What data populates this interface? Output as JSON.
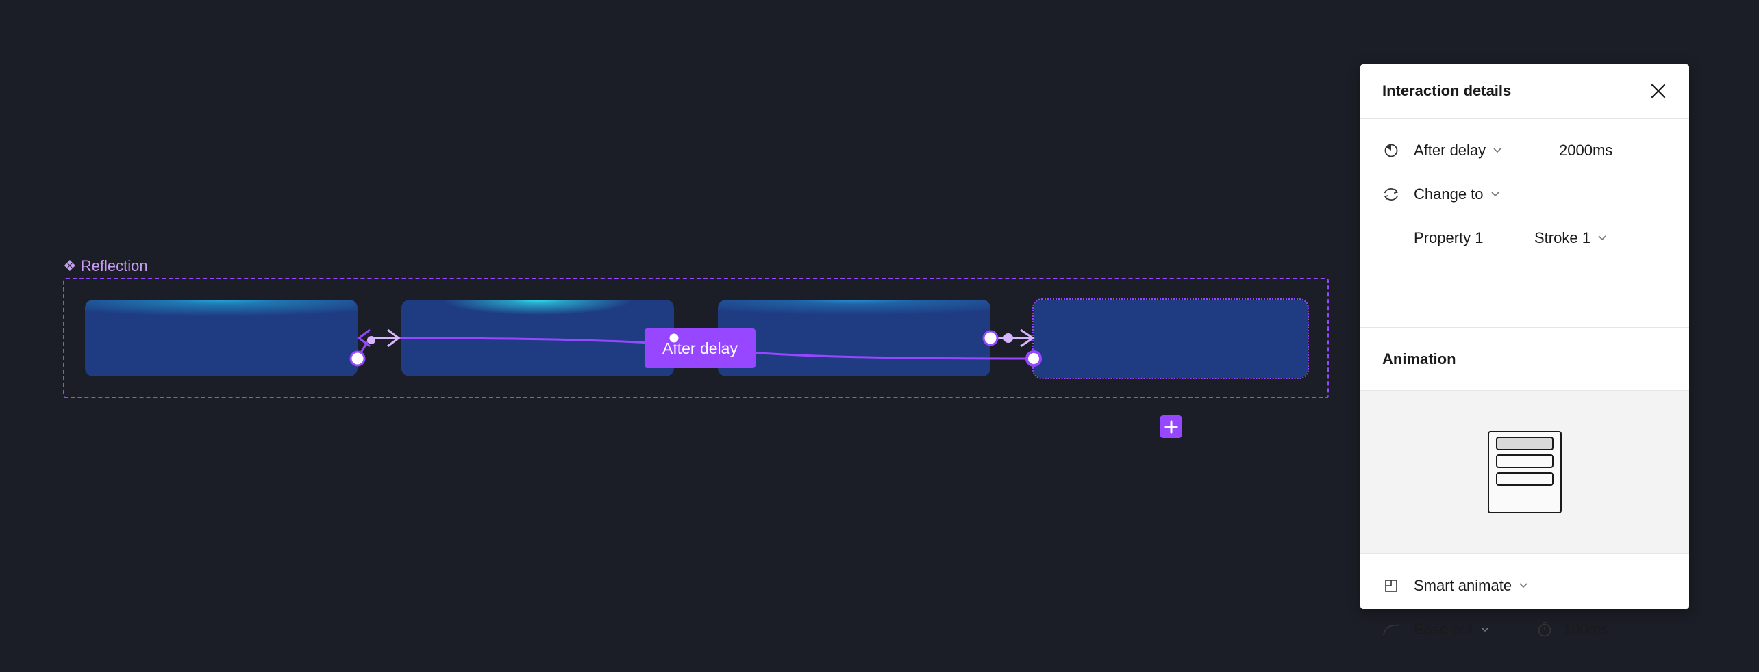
{
  "canvas": {
    "frame_label": "Reflection",
    "trigger_label": "After delay",
    "colors": {
      "background": "#1b1e26",
      "prototype_accent": "#9747ff",
      "variant_fill": "#1f3b82",
      "glow": "#2ee0f0"
    },
    "variants_count": 4
  },
  "panel": {
    "title": "Interaction details",
    "trigger": {
      "label": "After delay",
      "delay": "2000ms"
    },
    "action": {
      "label": "Change to"
    },
    "property": {
      "name": "Property 1",
      "value": "Stroke 1"
    },
    "animation_title": "Animation",
    "animation": {
      "type": "Smart animate",
      "easing": "Ease out",
      "duration": "100ms"
    }
  },
  "icons": {
    "close": "close-icon",
    "trigger": "delay-clock-icon",
    "action": "change-to-swap-icon",
    "animation_type": "smart-animate-icon",
    "easing": "ease-curve-icon",
    "duration": "timer-icon",
    "add_variant": "plus-icon",
    "component_set": "component-set-icon"
  }
}
